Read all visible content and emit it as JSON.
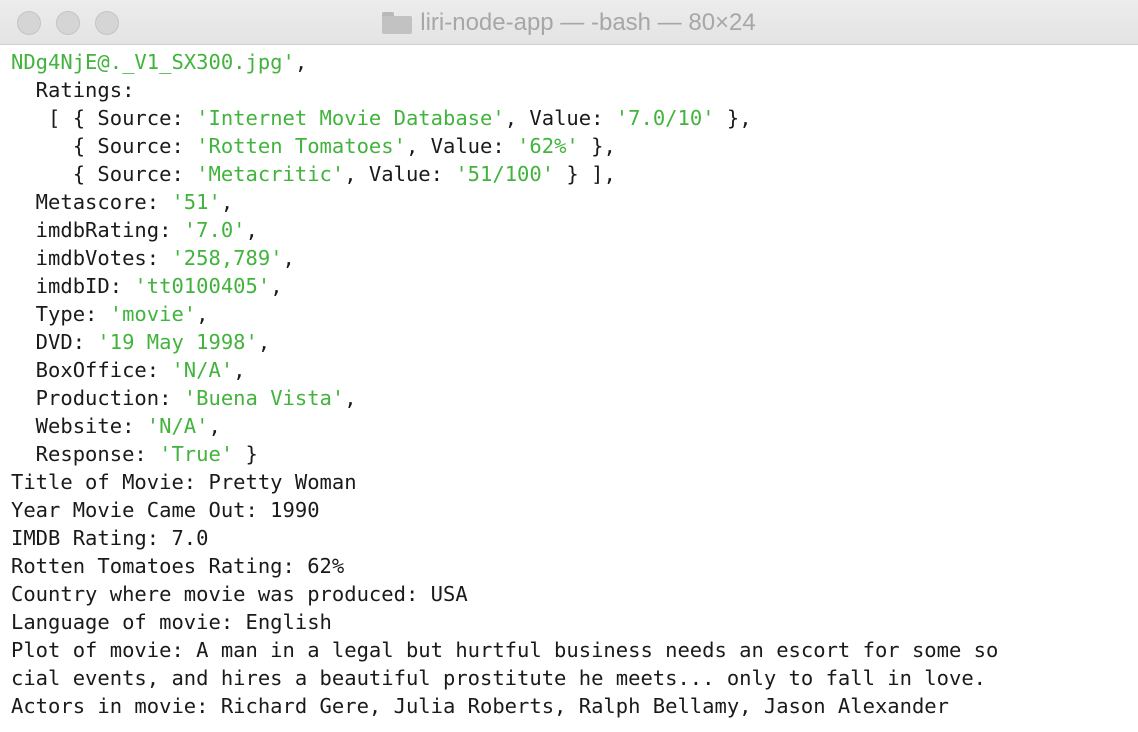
{
  "window": {
    "title": "liri-node-app — -bash — 80×24",
    "title_icon": "folder-icon",
    "controls": [
      "close-button",
      "minimize-button",
      "zoom-button"
    ]
  },
  "colors": {
    "string_green": "#42b33d",
    "text": "#1a1a1a",
    "titlebar": "#e8e8e8"
  },
  "terminal": {
    "lines": [
      [
        {
          "t": "NDg4NjE@._V1_SX300.jpg'",
          "c": "g"
        },
        {
          "t": ","
        }
      ],
      [
        {
          "t": "  Ratings:"
        }
      ],
      [
        {
          "t": "   [ { Source: "
        },
        {
          "t": "'Internet Movie Database'",
          "c": "g"
        },
        {
          "t": ", Value: "
        },
        {
          "t": "'7.0/10'",
          "c": "g"
        },
        {
          "t": " },"
        }
      ],
      [
        {
          "t": "     { Source: "
        },
        {
          "t": "'Rotten Tomatoes'",
          "c": "g"
        },
        {
          "t": ", Value: "
        },
        {
          "t": "'62%'",
          "c": "g"
        },
        {
          "t": " },"
        }
      ],
      [
        {
          "t": "     { Source: "
        },
        {
          "t": "'Metacritic'",
          "c": "g"
        },
        {
          "t": ", Value: "
        },
        {
          "t": "'51/100'",
          "c": "g"
        },
        {
          "t": " } ],"
        }
      ],
      [
        {
          "t": "  Metascore: "
        },
        {
          "t": "'51'",
          "c": "g"
        },
        {
          "t": ","
        }
      ],
      [
        {
          "t": "  imdbRating: "
        },
        {
          "t": "'7.0'",
          "c": "g"
        },
        {
          "t": ","
        }
      ],
      [
        {
          "t": "  imdbVotes: "
        },
        {
          "t": "'258,789'",
          "c": "g"
        },
        {
          "t": ","
        }
      ],
      [
        {
          "t": "  imdbID: "
        },
        {
          "t": "'tt0100405'",
          "c": "g"
        },
        {
          "t": ","
        }
      ],
      [
        {
          "t": "  Type: "
        },
        {
          "t": "'movie'",
          "c": "g"
        },
        {
          "t": ","
        }
      ],
      [
        {
          "t": "  DVD: "
        },
        {
          "t": "'19 May 1998'",
          "c": "g"
        },
        {
          "t": ","
        }
      ],
      [
        {
          "t": "  BoxOffice: "
        },
        {
          "t": "'N/A'",
          "c": "g"
        },
        {
          "t": ","
        }
      ],
      [
        {
          "t": "  Production: "
        },
        {
          "t": "'Buena Vista'",
          "c": "g"
        },
        {
          "t": ","
        }
      ],
      [
        {
          "t": "  Website: "
        },
        {
          "t": "'N/A'",
          "c": "g"
        },
        {
          "t": ","
        }
      ],
      [
        {
          "t": "  Response: "
        },
        {
          "t": "'True'",
          "c": "g"
        },
        {
          "t": " }"
        }
      ],
      [
        {
          "t": "Title of Movie: Pretty Woman"
        }
      ],
      [
        {
          "t": "Year Movie Came Out: 1990"
        }
      ],
      [
        {
          "t": "IMDB Rating: 7.0"
        }
      ],
      [
        {
          "t": "Rotten Tomatoes Rating: 62%"
        }
      ],
      [
        {
          "t": "Country where movie was produced: USA"
        }
      ],
      [
        {
          "t": "Language of movie: English"
        }
      ],
      [
        {
          "t": "Plot of movie: A man in a legal but hurtful business needs an escort for some so"
        }
      ],
      [
        {
          "t": "cial events, and hires a beautiful prostitute he meets... only to fall in love."
        }
      ],
      [
        {
          "t": "Actors in movie: Richard Gere, Julia Roberts, Ralph Bellamy, Jason Alexander"
        }
      ]
    ]
  }
}
